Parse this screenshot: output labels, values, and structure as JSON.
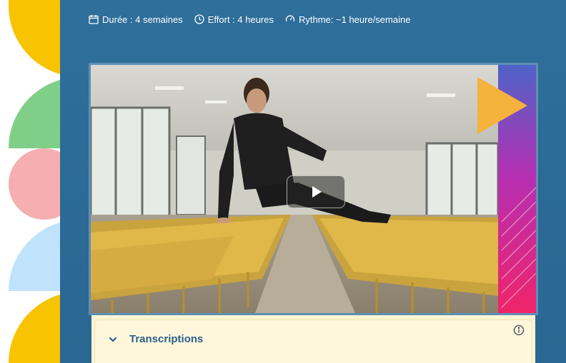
{
  "meta": {
    "duration": "Durée : 4 semaines",
    "effort": "Effort : 4 heures",
    "rhythm": "Rythme: ~1 heure/semaine"
  },
  "video": {
    "play_icon": "play-icon"
  },
  "transcriptions": {
    "label": "Transcriptions",
    "toggle_icon": "chevron-down-icon",
    "info_icon": "info-icon"
  },
  "colors": {
    "page_blue": "#2f6f9a",
    "panel_bg": "#fef7dc",
    "link_blue": "#2a5f8c",
    "deco_yellow": "#f8c300",
    "deco_green": "#7fcf88",
    "deco_pink": "#f6aeb0",
    "deco_light_blue": "#bfe3fb"
  }
}
